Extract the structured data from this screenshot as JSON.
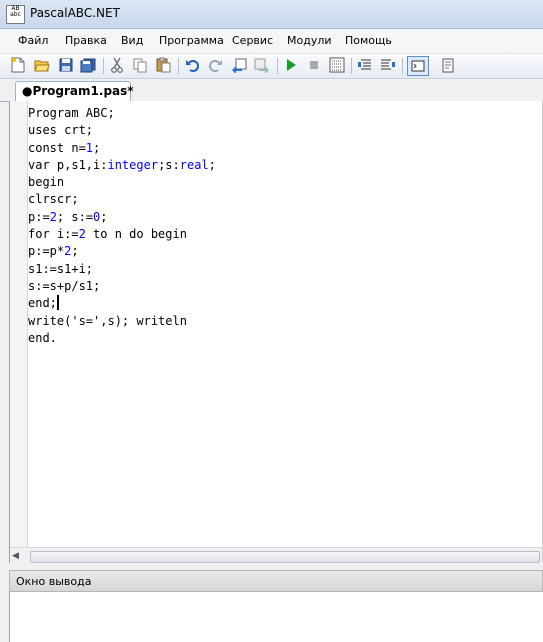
{
  "window": {
    "title": "PascalABC.NET",
    "icon": "pascalabc-app-icon"
  },
  "menu": {
    "items": [
      {
        "label": "Файл"
      },
      {
        "label": "Правка"
      },
      {
        "label": "Вид"
      },
      {
        "label": "Программа"
      },
      {
        "label": "Сервис"
      },
      {
        "label": "Модули"
      },
      {
        "label": "Помощь"
      }
    ]
  },
  "toolbar": {
    "buttons": [
      "new-file-icon",
      "open-folder-icon",
      "save-icon",
      "save-all-icon",
      "cut-icon",
      "copy-icon",
      "paste-icon",
      "undo-icon",
      "redo-icon",
      "step-back-icon",
      "step-forward-icon",
      "run-icon",
      "stop-icon",
      "debug-icon",
      "comment-icon",
      "uncomment-icon",
      "output-window-icon",
      "compile-icon"
    ]
  },
  "tabs": [
    {
      "label": "●Program1.pas*",
      "active": true
    }
  ],
  "editor": {
    "lines": [
      "Program ABC;",
      "uses crt;",
      "const n=1;",
      "var p,s1,i:integer;s:real;",
      "begin",
      "clrscr;",
      "p:=2; s:=0;",
      "for i:=2 to n do begin",
      "p:=p*2;",
      "s1:=s1+i;",
      "s:=s+p/s1;",
      "end;",
      "write('s=',s); writeln",
      "end."
    ],
    "keyword_color": "#0000ff"
  },
  "output": {
    "title": "Окно вывода"
  }
}
